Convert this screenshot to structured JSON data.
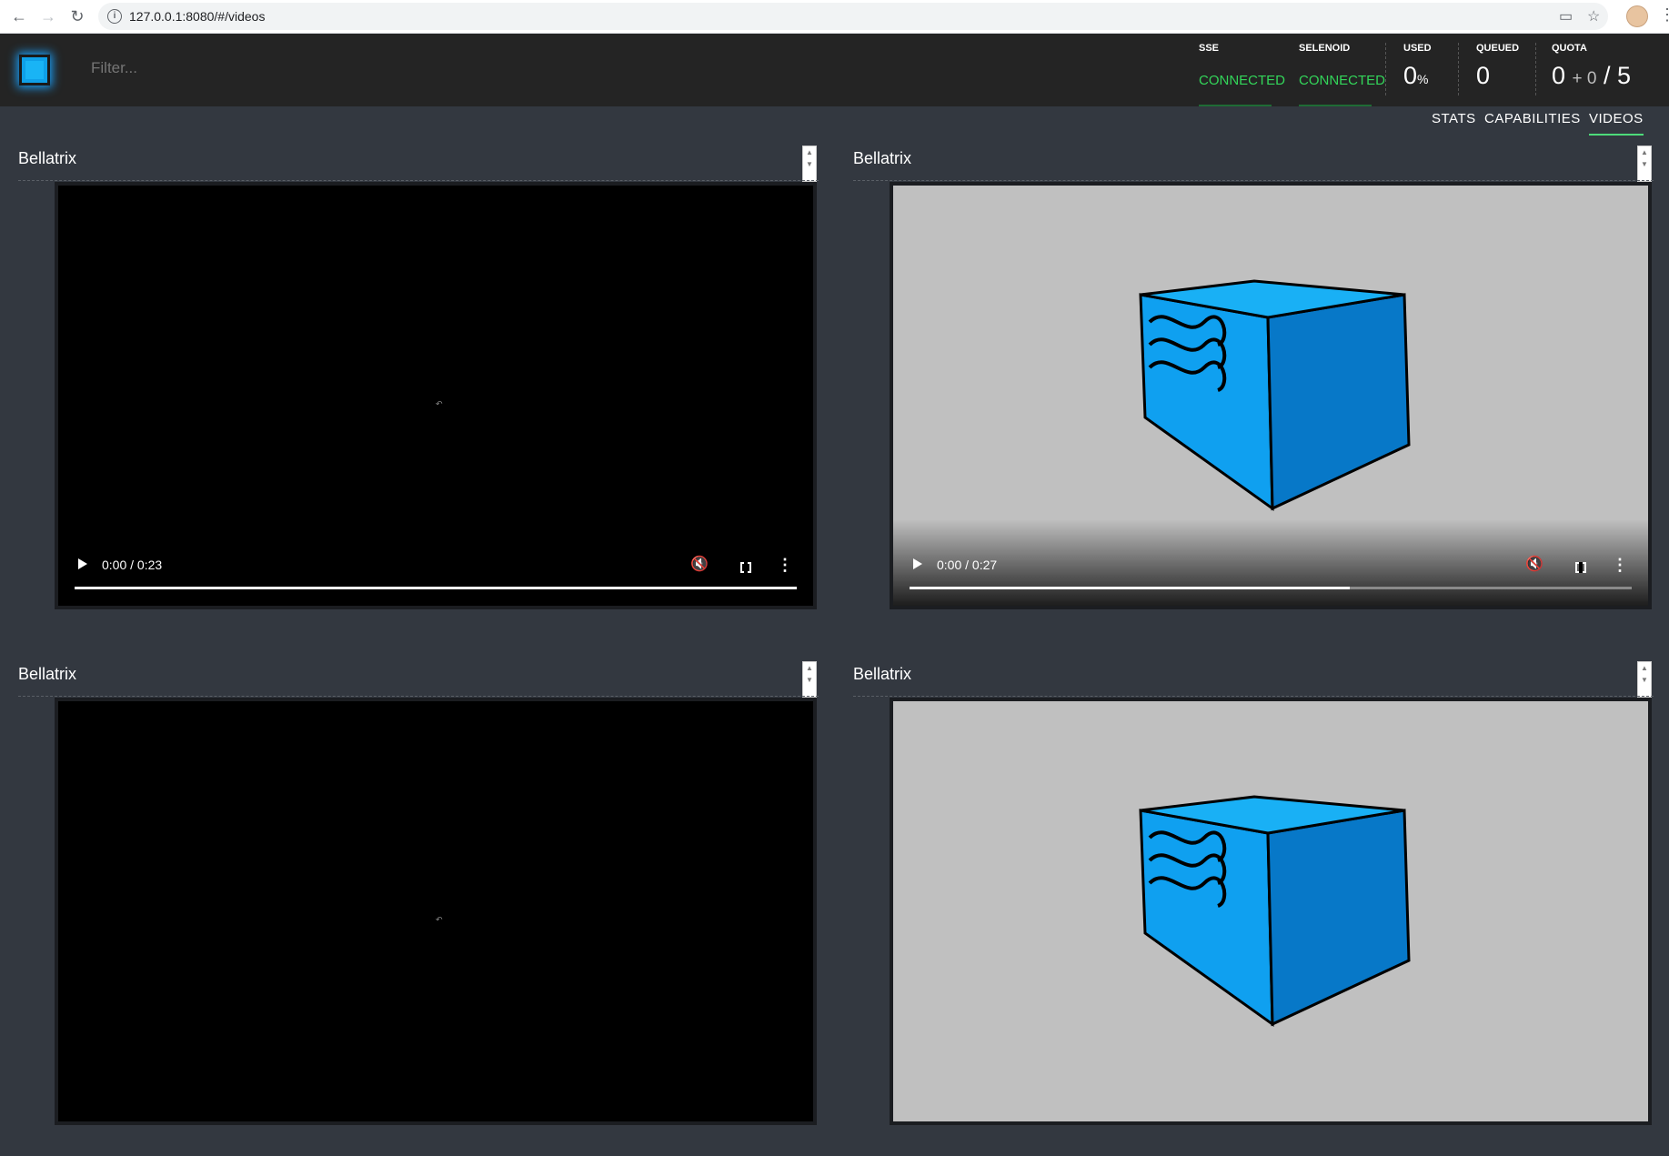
{
  "browser": {
    "url": "127.0.0.1:8080/#/videos"
  },
  "header": {
    "filter_placeholder": "Filter...",
    "sse": {
      "label": "SSE",
      "status": "CONNECTED"
    },
    "selenoid": {
      "label": "SELENOID",
      "status": "CONNECTED"
    },
    "used": {
      "label": "USED",
      "value": "0",
      "unit": "%"
    },
    "queued": {
      "label": "QUEUED",
      "value": "0"
    },
    "quota": {
      "label": "QUOTA",
      "value": "0",
      "pending": "+ 0",
      "total": "/ 5"
    },
    "status_color": "#33d65a",
    "accent_color": "#19b4f5"
  },
  "tabs": [
    {
      "label": "STATS",
      "active": false
    },
    {
      "label": "CAPABILITIES",
      "active": false
    },
    {
      "label": "VIDEOS",
      "active": true
    }
  ],
  "videos": [
    {
      "title": "Bellatrix",
      "time": "0:00 / 0:23",
      "thumbnail": "black",
      "progress": 1.0
    },
    {
      "title": "Bellatrix",
      "time": "0:00 / 0:27",
      "thumbnail": "cube-logo",
      "progress": 0.61
    },
    {
      "title": "Bellatrix",
      "time": "",
      "thumbnail": "black",
      "progress": 0
    },
    {
      "title": "Bellatrix",
      "time": "",
      "thumbnail": "cube-logo",
      "progress": 0
    }
  ]
}
